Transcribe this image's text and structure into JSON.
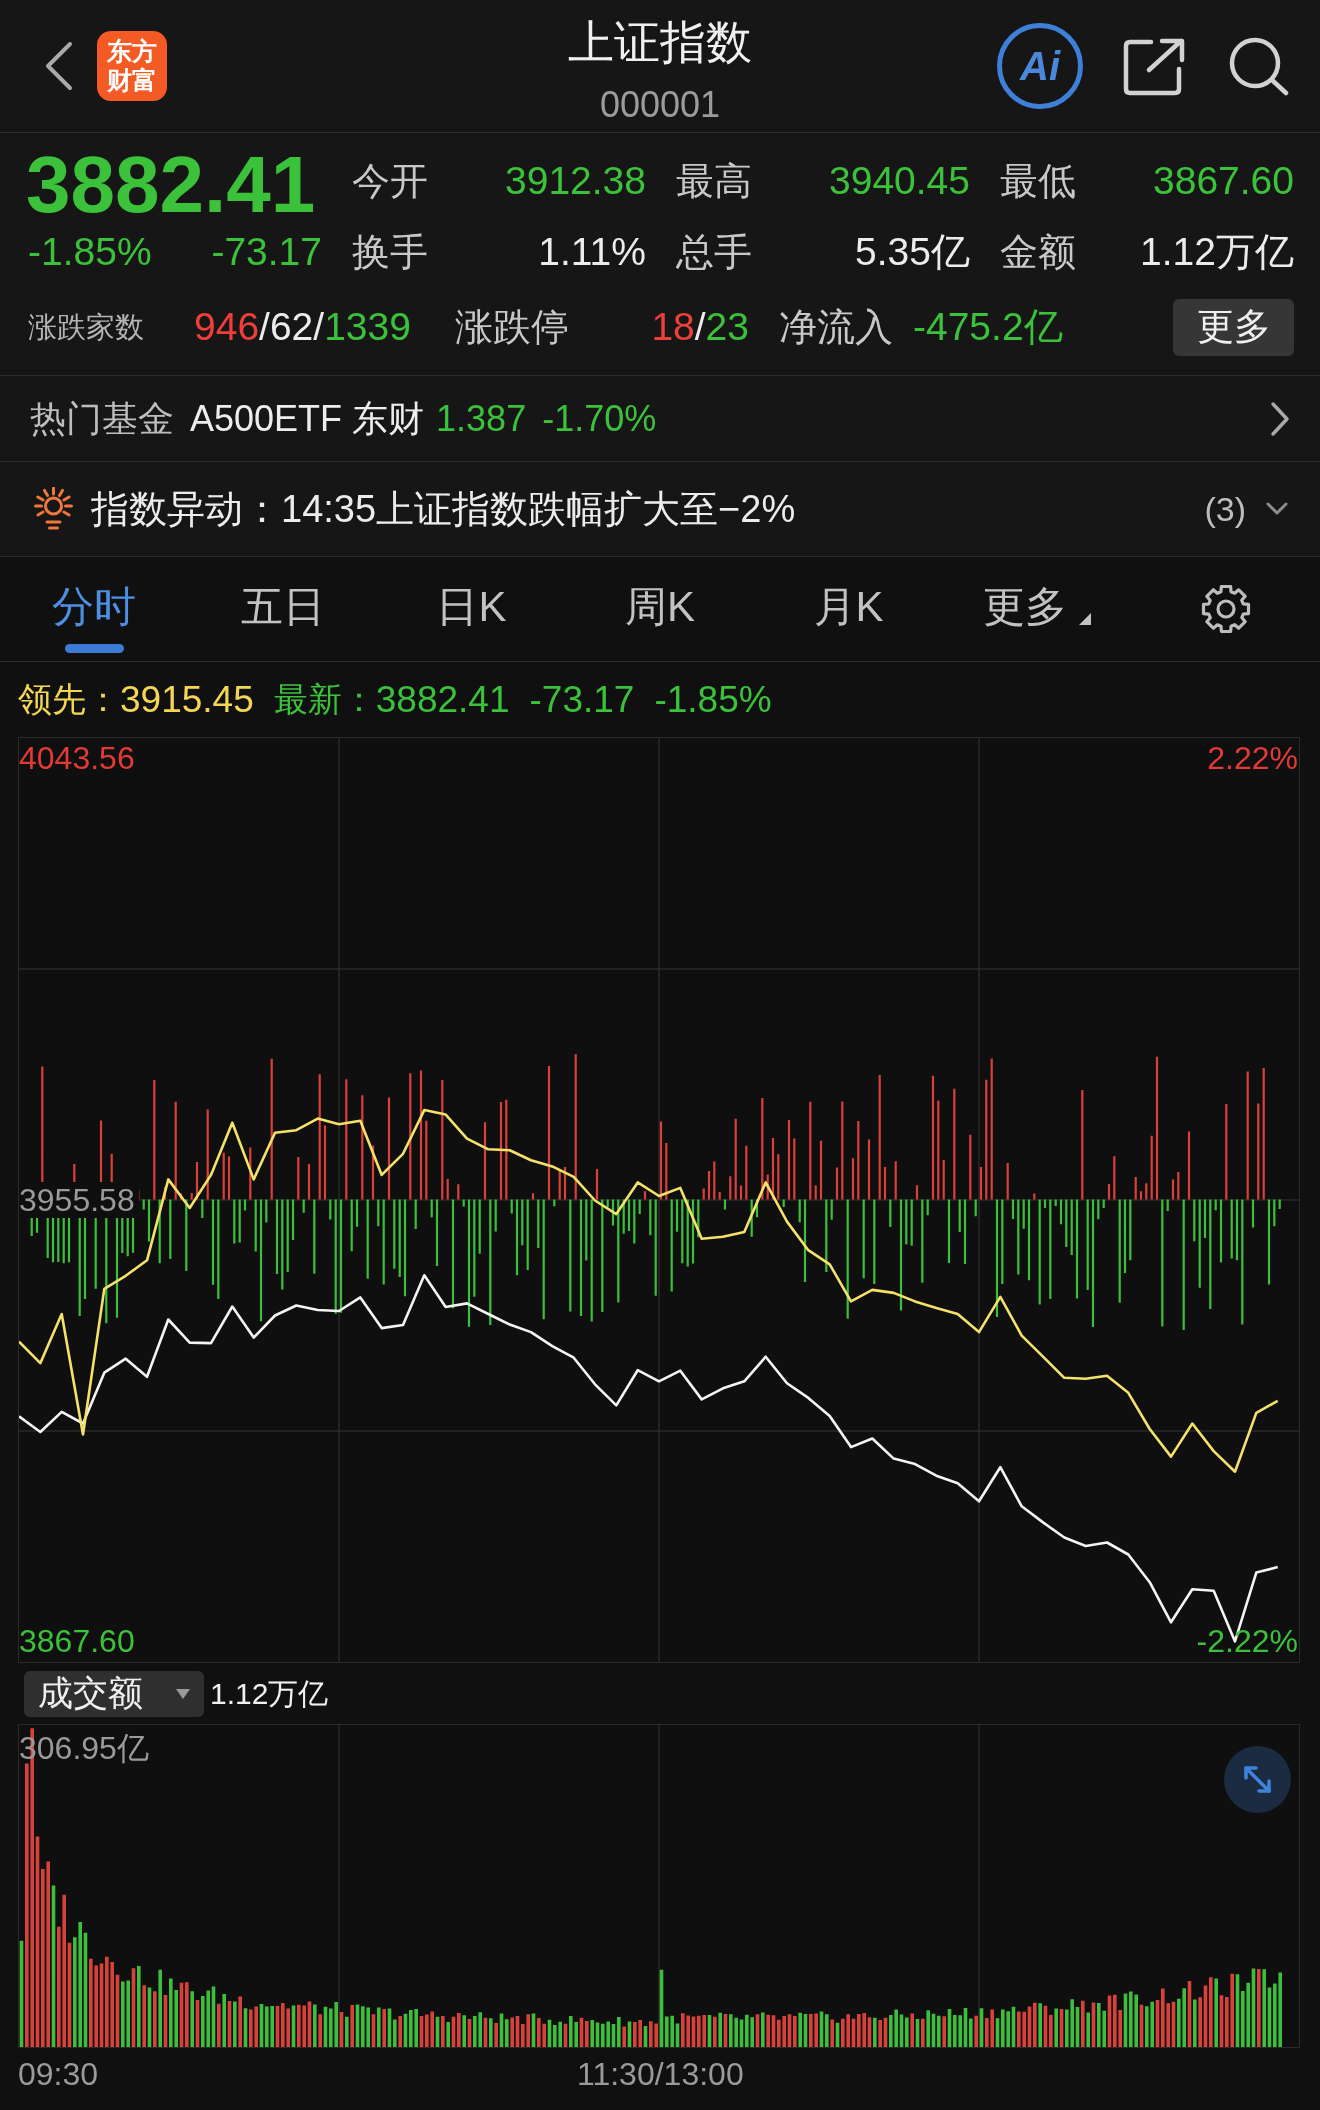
{
  "header": {
    "logo_lines": [
      "东方",
      "财富"
    ],
    "title": "上证指数",
    "code": "000001",
    "ai_label": "Ai"
  },
  "quote": {
    "price": "3882.41",
    "change_pct": "-1.85%",
    "change": "-73.17",
    "color": "#3cc13b",
    "rows": [
      [
        {
          "label": "今开",
          "value": "3912.38",
          "color": "#3cc13b"
        },
        {
          "label": "最高",
          "value": "3940.45",
          "color": "#3cc13b"
        },
        {
          "label": "最低",
          "value": "3867.60",
          "color": "#3cc13b"
        }
      ],
      [
        {
          "label": "换手",
          "value": "1.11%",
          "color": "#ececec"
        },
        {
          "label": "总手",
          "value": "5.35亿",
          "color": "#ececec"
        },
        {
          "label": "金额",
          "value": "1.12万亿",
          "color": "#ececec"
        }
      ]
    ],
    "breadth": {
      "label": "涨跌家数",
      "parts": [
        {
          "text": "946",
          "color": "#ee3f3a"
        },
        {
          "text": "/62/",
          "color": "#ececec"
        },
        {
          "text": "1339",
          "color": "#3cc13b"
        }
      ]
    },
    "limits": {
      "label": "涨跌停",
      "parts": [
        {
          "text": "18",
          "color": "#ee3f3a"
        },
        {
          "text": "/",
          "color": "#ececec"
        },
        {
          "text": "23",
          "color": "#3cc13b"
        }
      ]
    },
    "net_inflow": {
      "label": "净流入",
      "value": "-475.2亿",
      "color": "#3cc13b"
    },
    "more_button": "更多"
  },
  "hot_fund": {
    "label": "热门基金",
    "name": "A500ETF 东财",
    "price": "1.387",
    "change_pct": "-1.70%",
    "color": "#3cc13b"
  },
  "alert": {
    "text": "指数异动：14:35上证指数跌幅扩大至−2%",
    "count": "(3)"
  },
  "tabs": [
    {
      "label": "分时",
      "selected": true,
      "kind": "tab"
    },
    {
      "label": "五日",
      "selected": false,
      "kind": "tab"
    },
    {
      "label": "日K",
      "selected": false,
      "kind": "tab"
    },
    {
      "label": "周K",
      "selected": false,
      "kind": "tab"
    },
    {
      "label": "月K",
      "selected": false,
      "kind": "tab"
    },
    {
      "label": "更多",
      "selected": false,
      "kind": "menu"
    }
  ],
  "legend": [
    {
      "values": [
        "3915.45"
      ],
      "color": "#f3d654"
    },
    {
      "values": [
        "3882.41",
        "-73.17",
        "-1.85%"
      ],
      "color": "#3cc13b"
    }
  ],
  "price_chart": {
    "pct_labels": [
      {
        "text": "2.22%",
        "color": "#e23b36"
      },
      {
        "text": "-2.22%",
        "color": "#3cc13b"
      }
    ],
    "chart_data": {
      "type": "line",
      "grid": true,
      "ylim": [
        3863.5,
        4047.5
      ],
      "yticks": [
        {
          "value": 3867.6,
          "label": "3867.60"
        },
        {
          "value": 3955.58,
          "label": "3955.58"
        },
        {
          "value": 4043.56,
          "label": "4043.56"
        }
      ],
      "categories": [
        null,
        null,
        null,
        null,
        null,
        null,
        null,
        null,
        null,
        null,
        null,
        null,
        null,
        null,
        null,
        null,
        null,
        null,
        null,
        null,
        null,
        null,
        null,
        null,
        null,
        null,
        null,
        null,
        null,
        null,
        null,
        null,
        null,
        null,
        null,
        null,
        null,
        null,
        null,
        null,
        null,
        null,
        null,
        null,
        null,
        null,
        null,
        null,
        null,
        null,
        null,
        null,
        null,
        null,
        null,
        null,
        null,
        null,
        null,
        null,
        null
      ],
      "series": [
        {
          "name": "领先：",
          "color": "#f5e26a",
          "values": [
            3927.3,
            3923.0,
            3932.8,
            3908.8,
            3937.8,
            3940.4,
            3943.5,
            3959.6,
            3953.9,
            3960.5,
            3970.9,
            3959.6,
            3968.9,
            3969.4,
            3971.7,
            3970.6,
            3971.3,
            3960.5,
            3964.7,
            3973.4,
            3972.5,
            3967.7,
            3965.6,
            3965.4,
            3963.4,
            3962.2,
            3960.1,
            3955.4,
            3952.7,
            3959.0,
            3956.3,
            3957.9,
            3947.8,
            3948.2,
            3949.1,
            3959.0,
            3951.2,
            3945.5,
            3942.7,
            3935.3,
            3937.6,
            3937.0,
            3935.3,
            3934.0,
            3932.8,
            3929.2,
            3936.2,
            3928.5,
            3924.3,
            3920.1,
            3919.9,
            3920.5,
            3917.1,
            3909.9,
            3904.4,
            3911.0,
            3905.5,
            3901.4,
            3913.1,
            3915.5,
            null
          ]
        },
        {
          "name": "最新：",
          "color": "#f4f4f4",
          "values": [
            3912.4,
            3909.3,
            3913.3,
            3911.0,
            3921.1,
            3923.9,
            3920.3,
            3931.7,
            3927.1,
            3927.0,
            3934.3,
            3928.1,
            3932.5,
            3934.5,
            3933.6,
            3933.4,
            3936.1,
            3930.0,
            3930.6,
            3940.5,
            3934.2,
            3934.9,
            3932.8,
            3930.7,
            3929.2,
            3926.4,
            3924.1,
            3918.8,
            3914.6,
            3921.6,
            3919.4,
            3921.5,
            3915.8,
            3918.0,
            3919.4,
            3924.3,
            3919.0,
            3916.1,
            3912.5,
            3906.3,
            3908.0,
            3904.0,
            3902.9,
            3900.6,
            3899.1,
            3895.5,
            3902.3,
            3894.5,
            3891.3,
            3888.3,
            3886.6,
            3887.3,
            3884.9,
            3879.4,
            3871.4,
            3878.0,
            3877.7,
            3867.6,
            3881.3,
            3882.4,
            null
          ]
        }
      ]
    }
  },
  "volume": {
    "selector": "成交额",
    "total": "1.12万亿",
    "max_label": "306.95亿"
  },
  "time_axis": [
    "09:30",
    "11:30/13:00"
  ]
}
